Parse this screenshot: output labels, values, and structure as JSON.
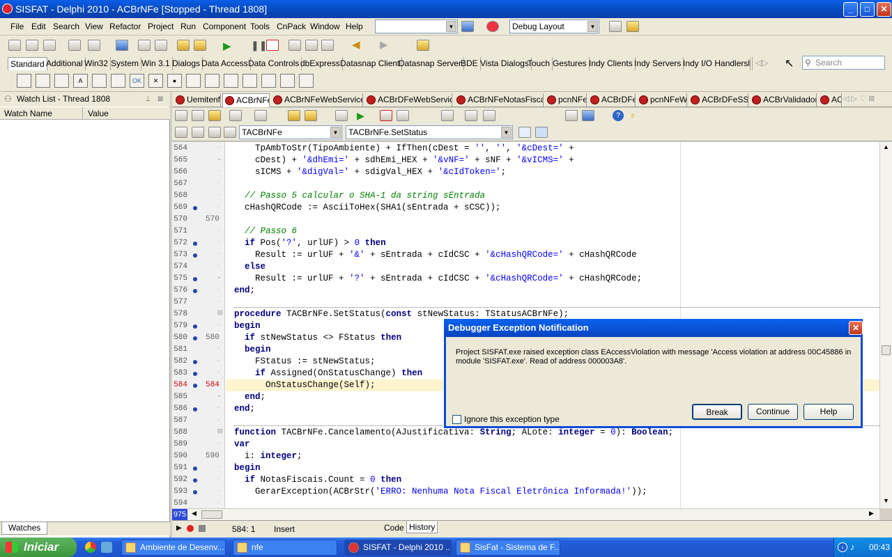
{
  "window": {
    "title": "SISFAT - Delphi 2010 - ACBrNFe [Stopped - Thread 1808]"
  },
  "menu": [
    "File",
    "Edit",
    "Search",
    "View",
    "Refactor",
    "Project",
    "Run",
    "Component",
    "Tools",
    "CnPack",
    "Window",
    "Help"
  ],
  "layout_combo": "Debug Layout",
  "palette_tabs": [
    "Standard",
    "Additional",
    "Win32",
    "System",
    "Win 3.1",
    "Dialogs",
    "Data Access",
    "Data Controls",
    "dbExpress",
    "Datasnap Client",
    "Datasnap Server",
    "BDE",
    "Vista Dialogs",
    "Touch",
    "Gestures",
    "Indy Clients",
    "Indy Servers",
    "Indy I/O Handlers",
    "I"
  ],
  "search_placeholder": "Search",
  "watch": {
    "title": "Watch List - Thread 1808",
    "col_name": "Watch Name",
    "col_value": "Value",
    "tab": "Watches"
  },
  "editor_tabs": [
    "Uemitenf",
    "ACBrNFe",
    "ACBrNFeWebServices",
    "ACBrDFeWebService",
    "ACBrNFeNotasFiscais",
    "pcnNFe",
    "ACBrDFe",
    "pcnNFeW",
    "ACBrDFeSSL",
    "ACBrValidador",
    "AC"
  ],
  "class_combo": "TACBrNFe",
  "method_combo": "TACBrNFe.SetStatus",
  "code_lines": [
    {
      "n": "564",
      "t": "    TpAmbToStr(TipoAmbiente) + IfThen(cDest = '', '', '&cDest=' +"
    },
    {
      "n": "565",
      "t": "    cDest) + '&dhEmi=' + sdhEmi_HEX + '&vNF=' + sNF + '&vICMS=' +"
    },
    {
      "n": "566",
      "t": "    sICMS + '&digVal=' + sdigVal_HEX + '&cIdToken=';"
    },
    {
      "n": "567",
      "t": ""
    },
    {
      "n": "568",
      "t": "  // Passo 5 calcular o SHA-1 da string sEntrada"
    },
    {
      "n": "569",
      "t": "  cHashQRCode := AsciiToHex(SHA1(sEntrada + sCSC));"
    },
    {
      "n": "570",
      "t": ""
    },
    {
      "n": "571",
      "t": "  // Passo 6"
    },
    {
      "n": "572",
      "t": "  if Pos('?', urlUF) > 0 then"
    },
    {
      "n": "573",
      "t": "    Result := urlUF + '&' + sEntrada + cIdCSC + '&cHashQRCode=' + cHashQRCode"
    },
    {
      "n": "574",
      "t": "  else"
    },
    {
      "n": "575",
      "t": "    Result := urlUF + '?' + sEntrada + cIdCSC + '&cHashQRCode=' + cHashQRCode;"
    },
    {
      "n": "576",
      "t": "end;"
    },
    {
      "n": "577",
      "t": ""
    },
    {
      "n": "578",
      "t": "procedure TACBrNFe.SetStatus(const stNewStatus: TStatusACBrNFe);"
    },
    {
      "n": "579",
      "t": "begin"
    },
    {
      "n": "580",
      "t": "  if stNewStatus <> FStatus then"
    },
    {
      "n": "581",
      "t": "  begin"
    },
    {
      "n": "582",
      "t": "    FStatus := stNewStatus;"
    },
    {
      "n": "583",
      "t": "    if Assigned(OnStatusChange) then"
    },
    {
      "n": "584",
      "t": "      OnStatusChange(Self);"
    },
    {
      "n": "585",
      "t": "  end;"
    },
    {
      "n": "586",
      "t": "end;"
    },
    {
      "n": "587",
      "t": ""
    },
    {
      "n": "588",
      "t": "function TACBrNFe.Cancelamento(AJustificativa: String; ALote: integer = 0): Boolean;"
    },
    {
      "n": "589",
      "t": "var"
    },
    {
      "n": "590",
      "t": "  i: integer;"
    },
    {
      "n": "591",
      "t": "begin"
    },
    {
      "n": "592",
      "t": "  if NotasFiscais.Count = 0 then"
    },
    {
      "n": "593",
      "t": "    GerarException(ACBrStr('ERRO: Nenhuma Nota Fiscal Eletrônica Informada!'));"
    },
    {
      "n": "594",
      "t": ""
    }
  ],
  "gutter_marks": [
    "570",
    "580",
    "584",
    "590"
  ],
  "lines_badge": "975",
  "status": {
    "pos": "584:  1",
    "mode": "Insert",
    "tab_code": "Code",
    "tab_history": "History"
  },
  "dialog": {
    "title": "Debugger Exception Notification",
    "message": "Project SISFAT.exe raised exception class EAccessViolation with message 'Access violation at address 00C45886 in module 'SISFAT.exe'. Read of address 000003A8'.",
    "ignore_label": "Ignore this exception type",
    "break": "Break",
    "continue": "Continue",
    "help": "Help"
  },
  "taskbar": {
    "start": "Iniciar",
    "items": [
      "Ambiente de Desenv...",
      "nfe",
      "SISFAT - Delphi 2010 ...",
      "SisFat - Sistema de F..."
    ],
    "clock": "00:43"
  }
}
